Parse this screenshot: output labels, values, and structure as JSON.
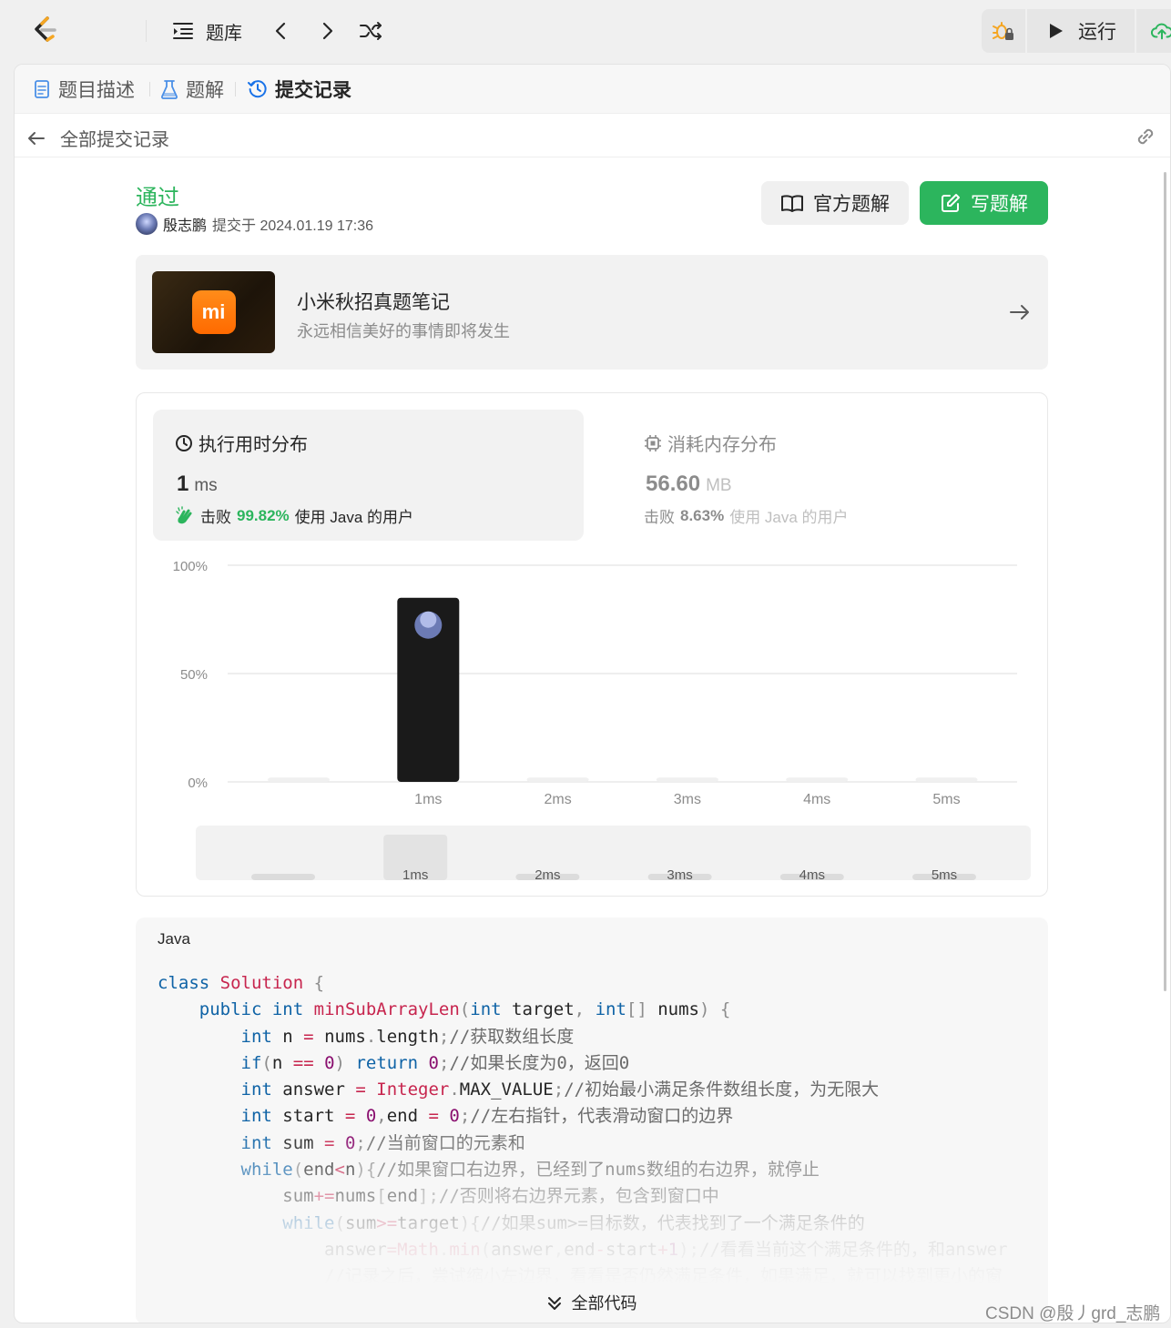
{
  "topbar": {
    "problem_bank": "题库",
    "run": "运行"
  },
  "tabs": {
    "description": "题目描述",
    "solutions": "题解",
    "submissions": "提交记录"
  },
  "subheader": {
    "back": "全部提交记录"
  },
  "submission": {
    "status": "通过",
    "user": "殷志鹏",
    "submitted_at": "提交于 2024.01.19 17:36",
    "official_solution": "官方题解",
    "write_solution": "写题解"
  },
  "promo": {
    "logo_text": "mi",
    "title": "小米秋招真题笔记",
    "subtitle": "永远相信美好的事情即将发生"
  },
  "runtime": {
    "title": "执行用时分布",
    "value": "1",
    "unit": "ms",
    "beat_prefix": "击败",
    "beat_pct": "99.82%",
    "beat_suffix": "使用 Java 的用户"
  },
  "memory": {
    "title": "消耗内存分布",
    "value": "56.60",
    "unit": "MB",
    "beat_prefix": "击败",
    "beat_pct": "8.63%",
    "beat_suffix": "使用 Java 的用户"
  },
  "chart_data": {
    "type": "bar",
    "y_ticks": [
      "100%",
      "50%",
      "0%"
    ],
    "ylim": [
      0,
      100
    ],
    "categories": [
      "",
      "1ms",
      "2ms",
      "3ms",
      "4ms",
      "5ms"
    ],
    "values": [
      2,
      85,
      2,
      2,
      2,
      2
    ],
    "highlight_index": 1,
    "colors": {
      "highlight": "#1a1a1a",
      "bar": "#f0f0f0",
      "grid": "#e8e8e8"
    },
    "mini_categories": [
      "",
      "1ms",
      "2ms",
      "3ms",
      "4ms",
      "5ms"
    ],
    "mini_values": [
      6,
      85,
      6,
      6,
      6,
      6
    ]
  },
  "code": {
    "language": "Java",
    "expand": "全部代码"
  },
  "watermark": "CSDN @殷丿grd_志鹏"
}
